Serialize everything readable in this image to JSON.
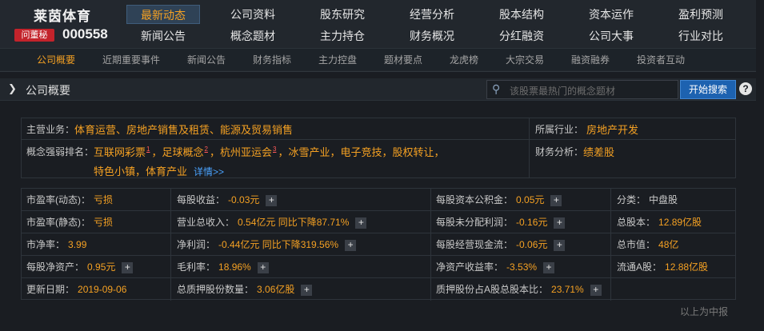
{
  "header": {
    "stock_name": "莱茵体育",
    "dm_badge": "问董秘",
    "stock_code": "000558",
    "main_tabs_row1": [
      "最新动态",
      "公司资料",
      "股东研究",
      "经营分析",
      "股本结构",
      "资本运作",
      "盈利预测"
    ],
    "main_tabs_row2": [
      "新闻公告",
      "概念题材",
      "主力持仓",
      "财务概况",
      "分红融资",
      "公司大事",
      "行业对比"
    ],
    "active_main_tab": "最新动态",
    "sub_tabs": [
      "公司概要",
      "近期重要事件",
      "新闻公告",
      "财务指标",
      "主力控盘",
      "题材要点",
      "龙虎榜",
      "大宗交易",
      "融资融券",
      "投资者互动"
    ],
    "active_sub_tab": "公司概要"
  },
  "section": {
    "title": "公司概要",
    "search_placeholder": "该股票最热门的概念题材",
    "search_button": "开始搜索",
    "help": "?"
  },
  "overview": {
    "main_business_label": "主营业务：",
    "main_business": "体育运营、房地产销售及租赁、能源及贸易销售",
    "industry_label": "所属行业：",
    "industry": "房地产开发",
    "concept_label": "概念强弱排名：",
    "concepts": [
      {
        "name": "互联网彩票",
        "rank": "1"
      },
      {
        "name": "足球概念",
        "rank": "2"
      },
      {
        "name": "杭州亚运会",
        "rank": "3"
      },
      {
        "name": "冰雪产业",
        "rank": ""
      },
      {
        "name": "电子竞技",
        "rank": ""
      },
      {
        "name": "股权转让",
        "rank": ""
      },
      {
        "name": "特色小镇",
        "rank": ""
      },
      {
        "name": "体育产业",
        "rank": ""
      }
    ],
    "concepts_more": "详情>>",
    "finance_label": "财务分析：",
    "finance": "绩差股"
  },
  "metrics": {
    "rows": [
      [
        {
          "label": "市盈率(动态)：",
          "value": "亏损",
          "plus": false
        },
        {
          "label": "每股收益：",
          "value": "-0.03元",
          "plus": true
        },
        {
          "label": "每股资本公积金：",
          "value": "0.05元",
          "plus": true
        },
        {
          "label": "分类：",
          "value": "中盘股",
          "plus": false,
          "plain": true
        }
      ],
      [
        {
          "label": "市盈率(静态)：",
          "value": "亏损",
          "plus": false
        },
        {
          "label": "营业总收入：",
          "value": "0.54亿元 同比下降87.71%",
          "plus": true
        },
        {
          "label": "每股未分配利润：",
          "value": "-0.16元",
          "plus": true
        },
        {
          "label": "总股本：",
          "value": "12.89亿股",
          "plus": false
        }
      ],
      [
        {
          "label": "市净率：",
          "value": "3.99",
          "plus": false
        },
        {
          "label": "净利润：",
          "value": "-0.44亿元 同比下降319.56%",
          "plus": true
        },
        {
          "label": "每股经营现金流：",
          "value": "-0.06元",
          "plus": true
        },
        {
          "label": "总市值：",
          "value": "48亿",
          "plus": false
        }
      ],
      [
        {
          "label": "每股净资产：",
          "value": "0.95元",
          "plus": true
        },
        {
          "label": "毛利率：",
          "value": "18.96%",
          "plus": true
        },
        {
          "label": "净资产收益率：",
          "value": "-3.53%",
          "plus": true
        },
        {
          "label": "流通A股：",
          "value": "12.88亿股",
          "plus": false
        }
      ],
      [
        {
          "label": "更新日期：",
          "value": "2019-09-06",
          "plus": false
        },
        {
          "label": "总质押股份数量：",
          "value": "3.06亿股",
          "plus": true
        },
        {
          "label": "质押股份占A股总股本比：",
          "value": "23.71%",
          "plus": true
        },
        {
          "label": "",
          "value": "",
          "plus": false
        }
      ]
    ]
  },
  "footer": {
    "note": "以上为中报"
  },
  "colors": {
    "accent": "#f5a123",
    "link": "#4aa3ff",
    "badge": "#c3232b",
    "button": "#1d62b0"
  }
}
